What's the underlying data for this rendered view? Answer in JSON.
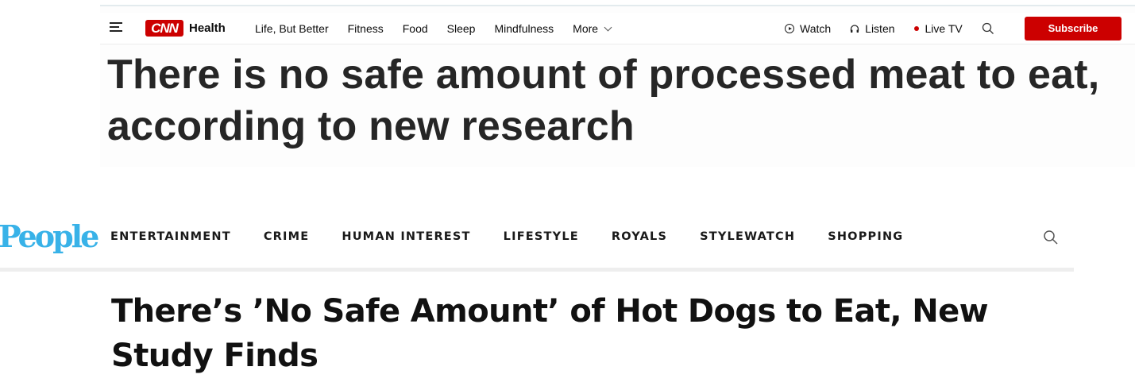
{
  "cnn": {
    "logo": "CNN",
    "section": "Health",
    "nav_links": [
      "Life, But Better",
      "Fitness",
      "Food",
      "Sleep",
      "Mindfulness"
    ],
    "more_label": "More",
    "watch_label": "Watch",
    "listen_label": "Listen",
    "live_tv_label": "Live TV",
    "subscribe_label": "Subscribe",
    "headline": "There is no safe amount of processed meat to eat, according to new research",
    "colors": {
      "brand": "#cc0000",
      "headline": "#262626"
    }
  },
  "people": {
    "logo": "People",
    "nav_links": [
      "ENTERTAINMENT",
      "CRIME",
      "HUMAN INTEREST",
      "LIFESTYLE",
      "ROYALS",
      "STYLEWATCH",
      "SHOPPING"
    ],
    "headline": "There’s ’No Safe Amount’ of Hot Dogs to Eat, New Study Finds",
    "colors": {
      "logo": "#38b2e8"
    }
  },
  "icons": {
    "cnn_menu": "hamburger-menu-icon",
    "cnn_more": "chevron-down-icon",
    "cnn_watch": "play-circle-icon",
    "cnn_listen": "headphones-icon",
    "cnn_live": "live-dot-icon",
    "cnn_search": "search-icon",
    "people_search": "search-icon"
  }
}
